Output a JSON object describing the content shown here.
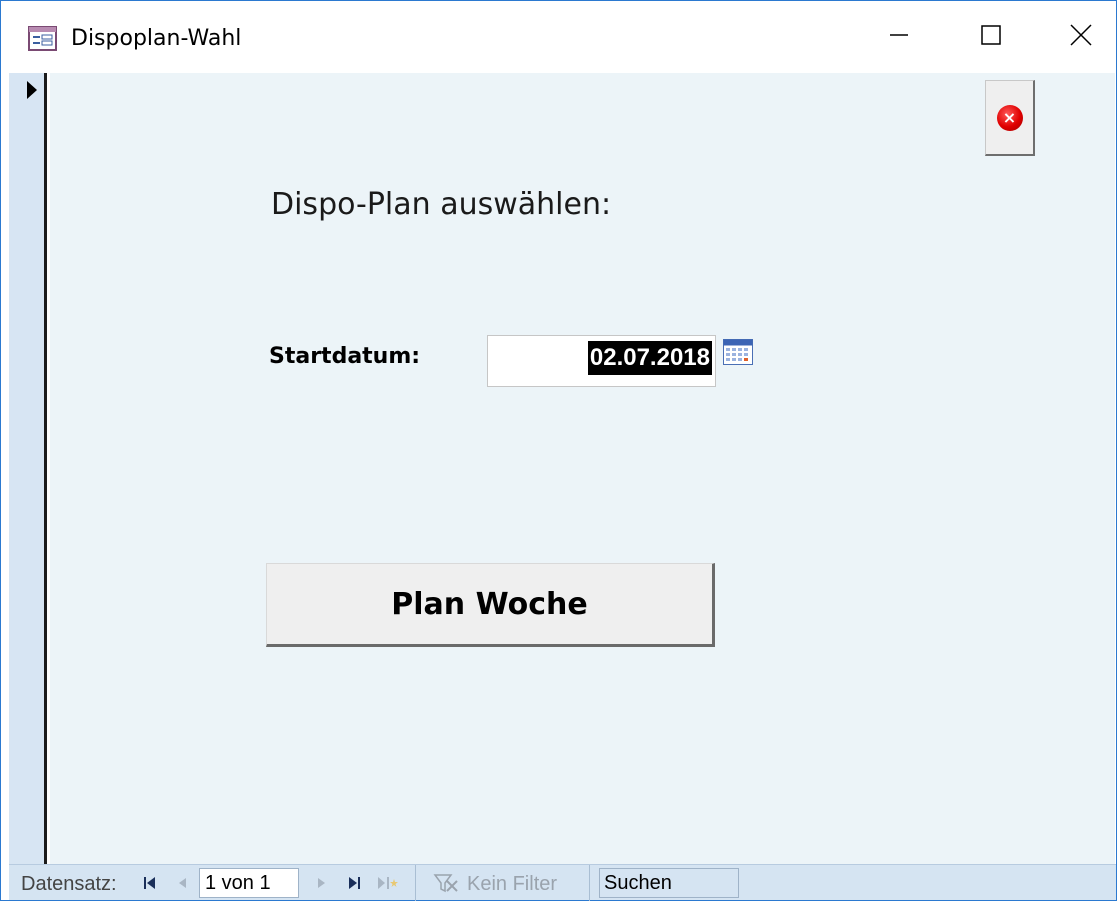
{
  "window": {
    "title": "Dispoplan-Wahl",
    "icon": "form-icon",
    "controls": [
      "minimize-icon",
      "maximize-icon",
      "close-icon"
    ]
  },
  "form": {
    "heading": "Dispo-Plan auswählen:",
    "start_label": "Startdatum:",
    "start_date": "02.07.2018",
    "date_picker_icon": "calendar-icon",
    "plan_button_label": "Plan Woche",
    "close_form_icon": "red-close-icon"
  },
  "navigation": {
    "label": "Datensatz:",
    "record_position": "1 von 1",
    "filter_label": "Kein Filter",
    "search_placeholder": "Suchen",
    "buttons": [
      "first-record-icon",
      "previous-record-icon",
      "next-record-icon",
      "last-record-icon",
      "new-record-icon"
    ]
  },
  "colors": {
    "form_background": "#ecf4f8",
    "record_selector": "#d7e5f3",
    "nav_bar": "#d5e4f2",
    "window_border": "#2b79d0",
    "close_button_red": "#e00000"
  }
}
